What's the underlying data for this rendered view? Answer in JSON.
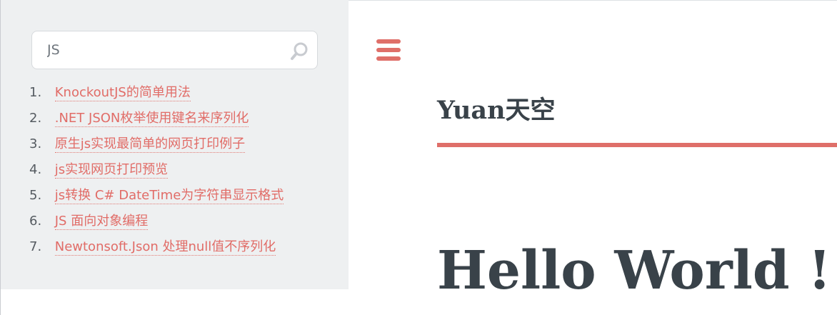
{
  "search": {
    "value": "JS",
    "icon": "search-icon"
  },
  "results": [
    {
      "number": "1.",
      "label": "KnockoutJS的简单用法"
    },
    {
      "number": "2.",
      "label": ".NET JSON枚举使用键名来序列化"
    },
    {
      "number": "3.",
      "label": "原生js实现最简单的网页打印例子"
    },
    {
      "number": "4.",
      "label": "js实现网页打印预览"
    },
    {
      "number": "5.",
      "label": "js转换 C# DateTime为字符串显示格式"
    },
    {
      "number": "6.",
      "label": "JS 面向对象编程"
    },
    {
      "number": "7.",
      "label": "Newtonsoft.Json 处理null值不序列化"
    }
  ],
  "header": {
    "menu_icon": "hamburger-menu-icon",
    "site_title": "Yuan天空",
    "post_title": "Hello World !"
  },
  "colors": {
    "accent": "#df6f69",
    "link": "#e16c67",
    "text": "#394249",
    "sidebar": "#eef0f1"
  }
}
